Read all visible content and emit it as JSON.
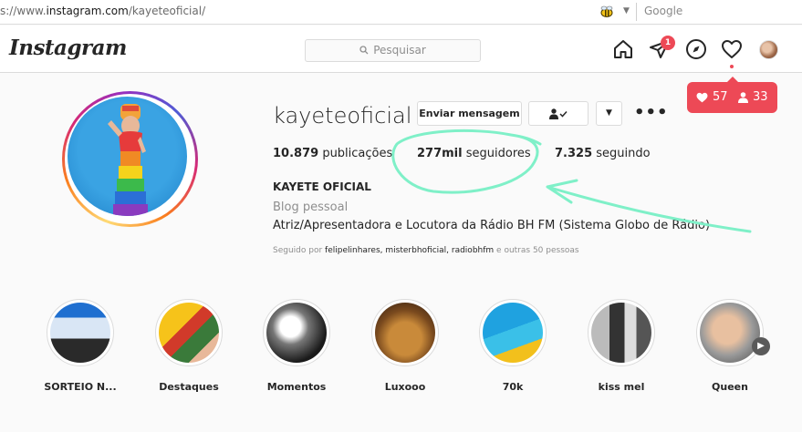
{
  "browser": {
    "url_prefix": "s://www.",
    "url_host": "instagram.com",
    "url_path": "/kayeteoficial/",
    "search_engine": "Google"
  },
  "nav": {
    "logo": "Instagram",
    "search_placeholder": "Pesquisar",
    "direct_badge": "1"
  },
  "activity": {
    "likes": "57",
    "follows": "33"
  },
  "profile": {
    "username": "kayeteoficial",
    "message_button": "Enviar mensagem",
    "stats": {
      "posts_value": "10.879",
      "posts_label": "publicações",
      "followers_value": "277mil",
      "followers_label": "seguidores",
      "following_value": "7.325",
      "following_label": "seguindo"
    },
    "full_name": "KAYETE OFICIAL",
    "category": "Blog pessoal",
    "bio": "Atriz/Apresentadora e Locutora da Rádio BH FM (Sistema Globo de Rádio)",
    "followed_by_prefix": "Seguido por",
    "followed_by_accounts": "felipelinhares, misterbhoficial, radiobhfm",
    "followed_by_suffix": "e outras 50 pessoas"
  },
  "highlights": [
    {
      "label": "SORTEIO N..."
    },
    {
      "label": "Destaques"
    },
    {
      "label": "Momentos"
    },
    {
      "label": "Luxooo"
    },
    {
      "label": "70k"
    },
    {
      "label": "kiss mel"
    },
    {
      "label": "Queen"
    }
  ],
  "colors": {
    "accent_red": "#ed4956",
    "annotation": "#7ff0c8"
  }
}
